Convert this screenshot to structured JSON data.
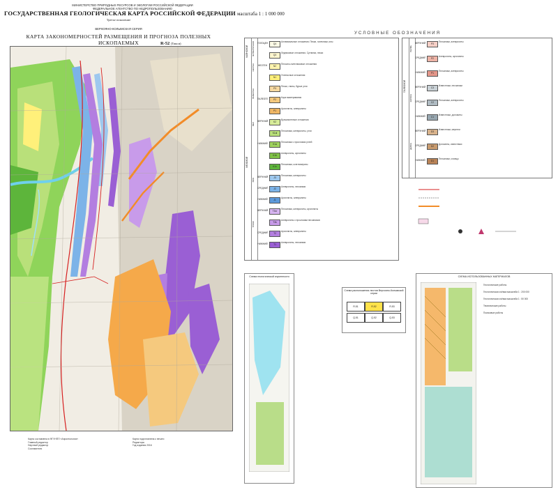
{
  "header": {
    "ministry_lines": [
      "МИНИСТЕРСТВО ПРИРОДНЫХ РЕСУРСОВ И ЭКОЛОГИИ РОССИЙСКОЙ ФЕДЕРАЦИИ",
      "ФЕДЕРАЛЬНОЕ АГЕНТСТВО ПО НЕДРОПОЛЬЗОВАНИЮ"
    ],
    "title": "ГОСУДАРСТВЕННАЯ ГЕОЛОГИЧЕСКАЯ КАРТА РОССИЙСКОЙ ФЕДЕРАЦИИ",
    "scale": "масштаба 1 : 1 000 000",
    "generation": "Третье поколение",
    "series": "ВЕРХОЯНО-КОЛЫМСКАЯ СЕРИЯ",
    "map_title": "КАРТА ЗАКОНОМЕРНОСТЕЙ РАЗМЕЩЕНИЯ И ПРОГНОЗА ПОЛЕЗНЫХ ИСКОПАЕМЫХ",
    "sheet_code": "R-52",
    "sheet_name": "(Тикси)"
  },
  "legend": {
    "title": "УСЛОВНЫЕ ОБОЗНАЧЕНИЯ",
    "eras_left": [
      "КАЙНОЗОЙ",
      "МЕЗОЗОЙ"
    ],
    "periods_left": [
      "ЧЕТВЕРТИЧНАЯ",
      "НЕОГЕН",
      "ПАЛЕОГЕН",
      "МЕЛ",
      "ЮРА",
      "ТРИАС"
    ],
    "rows_left": [
      {
        "code": "Q4",
        "color": "#fdfbe6",
        "age": "ГОЛОЦЕН",
        "text": "Аллювиальные отложения. Пески, галечники, илы"
      },
      {
        "code": "Q3",
        "color": "#fdf6cf",
        "age": "",
        "text": "Ледниковые отложения. Суглинки, пески"
      },
      {
        "code": "N2",
        "color": "#fff5b0",
        "age": "НЕОГЕН",
        "text": "Песчано-галечниковые отложения"
      },
      {
        "code": "N1",
        "color": "#fff07a",
        "age": "",
        "text": "Угленосные отложения"
      },
      {
        "code": "P3",
        "color": "#f7d9a0",
        "age": "",
        "text": "Пески, глины, бурые угли"
      },
      {
        "code": "P2",
        "color": "#f5c97e",
        "age": "ПАЛЕОГЕН",
        "text": "Кора выветривания"
      },
      {
        "code": "P1",
        "color": "#f0b765",
        "age": "",
        "text": "Аргиллиты, алевролиты"
      },
      {
        "code": "K2",
        "color": "#d7ec9a",
        "age": "ВЕРХНИЙ",
        "text": "Вулканогенные отложения"
      },
      {
        "code": "K1al",
        "color": "#b9e07a",
        "age": "",
        "text": "Песчаники, алевролиты, угли"
      },
      {
        "code": "K1a",
        "color": "#9fd35d",
        "age": "НИЖНИЙ",
        "text": "Песчаники с прослоями углей"
      },
      {
        "code": "K1b",
        "color": "#7fc246",
        "age": "",
        "text": "Алевролиты, аргиллиты"
      },
      {
        "code": "K1v",
        "color": "#5db53b",
        "age": "",
        "text": "Песчаники, конгломераты"
      },
      {
        "code": "J3",
        "color": "#9ec8ef",
        "age": "ВЕРХНИЙ",
        "text": "Песчаники, алевролиты"
      },
      {
        "code": "J2",
        "color": "#7cb3e8",
        "age": "СРЕДНИЙ",
        "text": "Алевролиты, песчаники"
      },
      {
        "code": "J1",
        "color": "#5d99db",
        "age": "НИЖНИЙ",
        "text": "Аргиллиты, алевролиты"
      },
      {
        "code": "T3nr",
        "color": "#d7b5f2",
        "age": "ВЕРХНИЙ",
        "text": "Песчаники, алевролиты, аргиллиты"
      },
      {
        "code": "T3k",
        "color": "#c89bea",
        "age": "",
        "text": "Алевролиты с прослоями песчаников"
      },
      {
        "code": "T2",
        "color": "#b37ee0",
        "age": "СРЕДНИЙ",
        "text": "Аргиллиты, алевролиты"
      },
      {
        "code": "T1",
        "color": "#9a5fd4",
        "age": "НИЖНИЙ",
        "text": "Алевролиты, песчаники"
      }
    ],
    "eras_right": [
      "ПАЛЕОЗОЙ"
    ],
    "periods_right": [
      "ПЕРМЬ",
      "КАРБОН",
      "ДЕВОН"
    ],
    "rows_right": [
      {
        "code": "P3",
        "color": "#f6cfc6",
        "age": "ВЕРХНИЙ",
        "text": "Песчаники, алевролиты"
      },
      {
        "code": "P2",
        "color": "#eeb3a6",
        "age": "СРЕДНИЙ",
        "text": "Алевролиты, аргиллиты"
      },
      {
        "code": "P1",
        "color": "#e4978a",
        "age": "НИЖНИЙ",
        "text": "Песчаники, алевролиты"
      },
      {
        "code": "C3",
        "color": "#c9d1d6",
        "age": "ВЕРХНИЙ",
        "text": "Известняки, песчаники"
      },
      {
        "code": "C2",
        "color": "#b0bcc3",
        "age": "СРЕДНИЙ",
        "text": "Песчаники, алевролиты"
      },
      {
        "code": "C1",
        "color": "#98a7b0",
        "age": "НИЖНИЙ",
        "text": "Известняки, доломиты"
      },
      {
        "code": "D3",
        "color": "#d9b38c",
        "age": "ВЕРХНИЙ",
        "text": "Известняки, мергели"
      },
      {
        "code": "D2",
        "color": "#c89b6f",
        "age": "СРЕДНИЙ",
        "text": "Доломиты, известняки"
      },
      {
        "code": "D1",
        "color": "#b98357",
        "age": "НИЖНИЙ",
        "text": "Песчаники, сланцы"
      }
    ]
  },
  "insets": {
    "left_title": "Схема геологической изученности",
    "center_title": "Схема расположения листов Верхояно-Колымской серии",
    "right_title": "СХЕМА ИСПОЛЬЗОВАННЫХ МАТЕРИАЛОВ",
    "center_grid": [
      "R-51",
      "R-52",
      "R-53",
      "Q-51",
      "Q-52",
      "Q-53"
    ],
    "right_notes": [
      "Геологические работы",
      "Геологическая съёмка масштаба 1 : 200 000",
      "Геологическая съёмка масштаба 1 : 50 000",
      "Тематические работы",
      "Поисковые работы"
    ]
  },
  "credits": {
    "left": [
      "Карта составлена в ФГУНПП «Аэрогеология»",
      "Главный редактор",
      "Научный редактор",
      "Составители"
    ],
    "right": [
      "Карта подготовлена к печати",
      "Редакторы",
      "Год издания 2016"
    ]
  },
  "colors": {
    "quaternary": "#fdf6cf",
    "cretaceous": "#8fd45a",
    "jurassic": "#7cb3e8",
    "triassic": "#b37ee0",
    "permian": "#eeb3a6",
    "orange_unit": "#f5a94a",
    "water": "#9fe0f2"
  }
}
